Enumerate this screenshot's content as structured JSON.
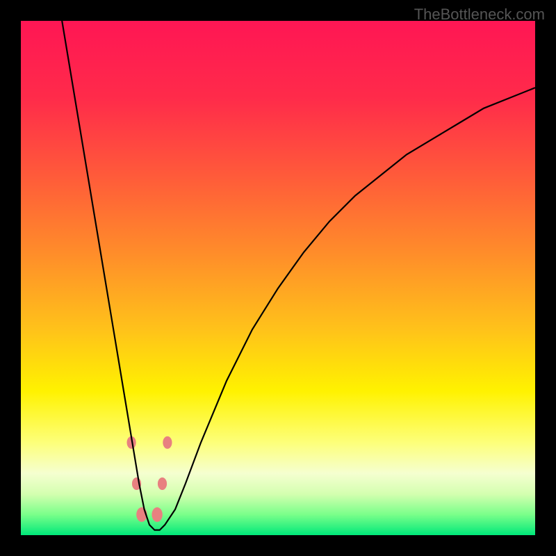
{
  "watermark": "TheBottleneck.com",
  "chart_data": {
    "type": "line",
    "title": "",
    "xlabel": "",
    "ylabel": "",
    "xlim": [
      0,
      100
    ],
    "ylim": [
      0,
      100
    ],
    "gradient_stops": [
      {
        "offset": 0,
        "color": "#ff1654"
      },
      {
        "offset": 15,
        "color": "#ff2b4a"
      },
      {
        "offset": 30,
        "color": "#ff5a3a"
      },
      {
        "offset": 45,
        "color": "#ff8c2a"
      },
      {
        "offset": 60,
        "color": "#ffc21a"
      },
      {
        "offset": 72,
        "color": "#fff200"
      },
      {
        "offset": 82,
        "color": "#fdff7a"
      },
      {
        "offset": 88,
        "color": "#f5ffd0"
      },
      {
        "offset": 92,
        "color": "#d4ffb0"
      },
      {
        "offset": 96,
        "color": "#7aff8a"
      },
      {
        "offset": 100,
        "color": "#00e87a"
      }
    ],
    "series": [
      {
        "name": "bottleneck-curve",
        "color": "#000000",
        "x": [
          8,
          10,
          12,
          14,
          16,
          18,
          20,
          21,
          22,
          23,
          24,
          25,
          26,
          27,
          28,
          30,
          32,
          35,
          40,
          45,
          50,
          55,
          60,
          65,
          70,
          75,
          80,
          85,
          90,
          95,
          100
        ],
        "y": [
          100,
          88,
          76,
          64,
          52,
          40,
          28,
          22,
          16,
          10,
          5,
          2,
          1,
          1,
          2,
          5,
          10,
          18,
          30,
          40,
          48,
          55,
          61,
          66,
          70,
          74,
          77,
          80,
          83,
          85,
          87
        ]
      }
    ],
    "markers": [
      {
        "x": 21.5,
        "y": 18,
        "color": "#e88080",
        "size": 12
      },
      {
        "x": 28.5,
        "y": 18,
        "color": "#e88080",
        "size": 12
      },
      {
        "x": 22.5,
        "y": 10,
        "color": "#e88080",
        "size": 12
      },
      {
        "x": 27.5,
        "y": 10,
        "color": "#e88080",
        "size": 12
      },
      {
        "x": 23.5,
        "y": 4,
        "color": "#e88080",
        "size": 14
      },
      {
        "x": 26.5,
        "y": 4,
        "color": "#e88080",
        "size": 14
      }
    ]
  }
}
